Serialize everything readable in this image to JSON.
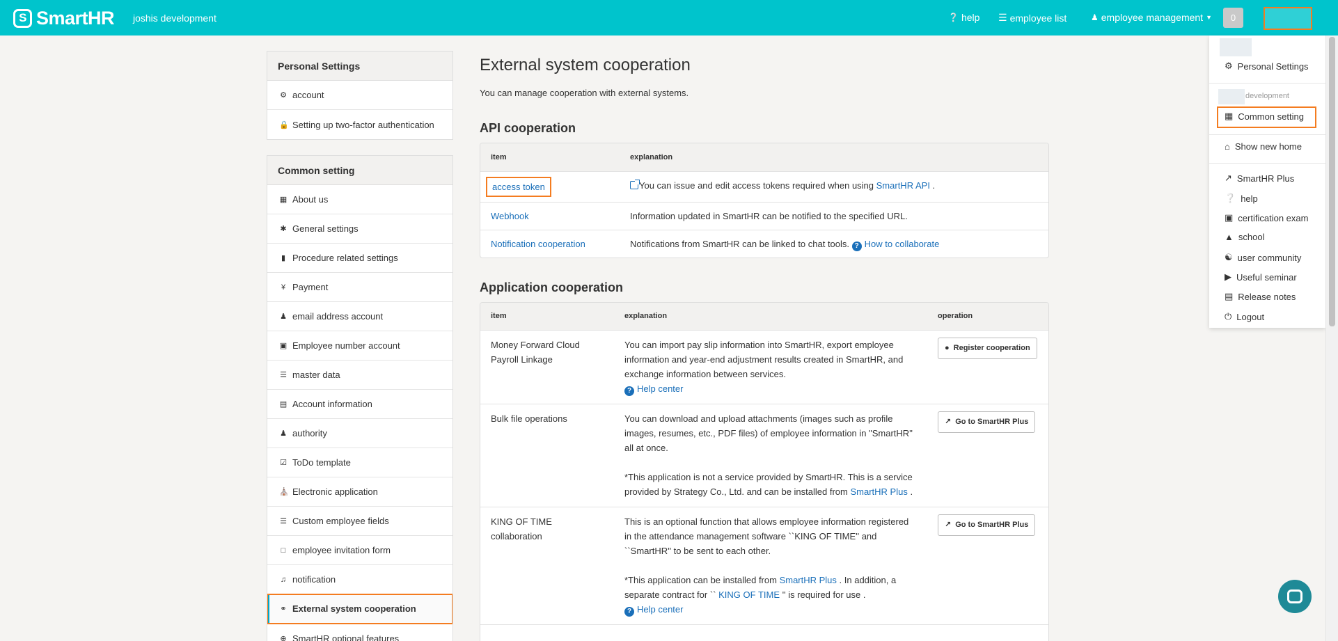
{
  "header": {
    "brand": "SmartHR",
    "brand_mark": "S",
    "tenant": "joshis development",
    "nav": {
      "help": "help",
      "employee_list": "employee list",
      "employee_management": "employee management"
    },
    "notification_count": "0",
    "accent_color": "#00c4cc"
  },
  "sidebar": {
    "personal_title": "Personal Settings",
    "personal_items": [
      "account",
      "Setting up two-factor authentication"
    ],
    "common_title": "Common setting",
    "common_items": [
      {
        "label": "About us",
        "icon": "building-icon"
      },
      {
        "label": "General settings",
        "icon": "asterisk-icon"
      },
      {
        "label": "Procedure related settings",
        "icon": "book-icon"
      },
      {
        "label": "Payment",
        "icon": "yen-icon"
      },
      {
        "label": "email address account",
        "icon": "users-icon"
      },
      {
        "label": "Employee number account",
        "icon": "id-card-icon"
      },
      {
        "label": "master data",
        "icon": "database-icon"
      },
      {
        "label": "Account information",
        "icon": "list-alt-icon"
      },
      {
        "label": "authority",
        "icon": "user-key-icon"
      },
      {
        "label": "ToDo template",
        "icon": "check-square-icon"
      },
      {
        "label": "Electronic application",
        "icon": "bank-icon"
      },
      {
        "label": "Custom employee fields",
        "icon": "list-icon"
      },
      {
        "label": "employee invitation form",
        "icon": "file-icon"
      },
      {
        "label": "notification",
        "icon": "bell-icon"
      },
      {
        "label": "External system cooperation",
        "icon": "link-icon"
      },
      {
        "label": "SmartHR optional features",
        "icon": "plus-circle-icon"
      }
    ]
  },
  "main": {
    "title": "External system cooperation",
    "description": "You can manage cooperation with external systems.",
    "api_section": {
      "title": "API cooperation",
      "columns": [
        "item",
        "explanation"
      ],
      "rows": [
        {
          "item": "access token",
          "explanation": "You can issue and edit access tokens required when using ",
          "link": "SmartHR API",
          "tail": " ."
        },
        {
          "item": "Webhook",
          "explanation": "Information updated in SmartHR can be notified to the specified URL."
        },
        {
          "item": "Notification cooperation",
          "explanation": "Notifications from SmartHR can be linked to chat tools. ",
          "link": "How to collaborate"
        }
      ]
    },
    "app_section": {
      "title": "Application cooperation",
      "columns": [
        "item",
        "explanation",
        "operation"
      ],
      "rows": [
        {
          "item": "Money Forward Cloud Payroll Linkage",
          "explanation": "You can import pay slip information into SmartHR, export employee information and year-end adjustment results created in SmartHR, and exchange information between services.",
          "help": "Help center",
          "button": "Register cooperation"
        },
        {
          "item": "Bulk file operations",
          "explanation": "You can download and upload attachments (images such as profile images, resumes, etc., PDF files) of employee information in \"SmartHR\" all at once.",
          "note": "*This application is not a service provided by SmartHR. This is a service provided by Strategy Co., Ltd. and can be installed from ",
          "note_link": "SmartHR Plus",
          "note_tail": " .",
          "button": "Go to SmartHR Plus"
        },
        {
          "item": "KING OF TIME collaboration",
          "explanation": "This is an optional function that allows employee information registered in the attendance management software ``KING OF TIME'' and ``SmartHR'' to be sent to each other.",
          "note": "*This application can be installed from ",
          "note_link": "SmartHR Plus",
          "note_mid": " . In addition, a separate contract for `` ",
          "note_link2": "KING OF TIME",
          "note_tail": " '' is required for use .",
          "help": "Help center",
          "button": "Go to SmartHR Plus"
        }
      ]
    }
  },
  "dropdown": {
    "personal_settings": "Personal Settings",
    "tenant_suffix": "development",
    "common_setting": "Common setting",
    "show_new_home": "Show new home",
    "links": [
      {
        "label": "SmartHR Plus",
        "icon": "external-link-icon"
      },
      {
        "label": "help",
        "icon": "question-circle-icon"
      },
      {
        "label": "certification exam",
        "icon": "certificate-icon"
      },
      {
        "label": "school",
        "icon": "graduation-cap-icon"
      },
      {
        "label": "user community",
        "icon": "handshake-icon"
      },
      {
        "label": "Useful seminar",
        "icon": "video-icon"
      },
      {
        "label": "Release notes",
        "icon": "newspaper-icon"
      },
      {
        "label": "Logout",
        "icon": "power-icon"
      }
    ]
  }
}
